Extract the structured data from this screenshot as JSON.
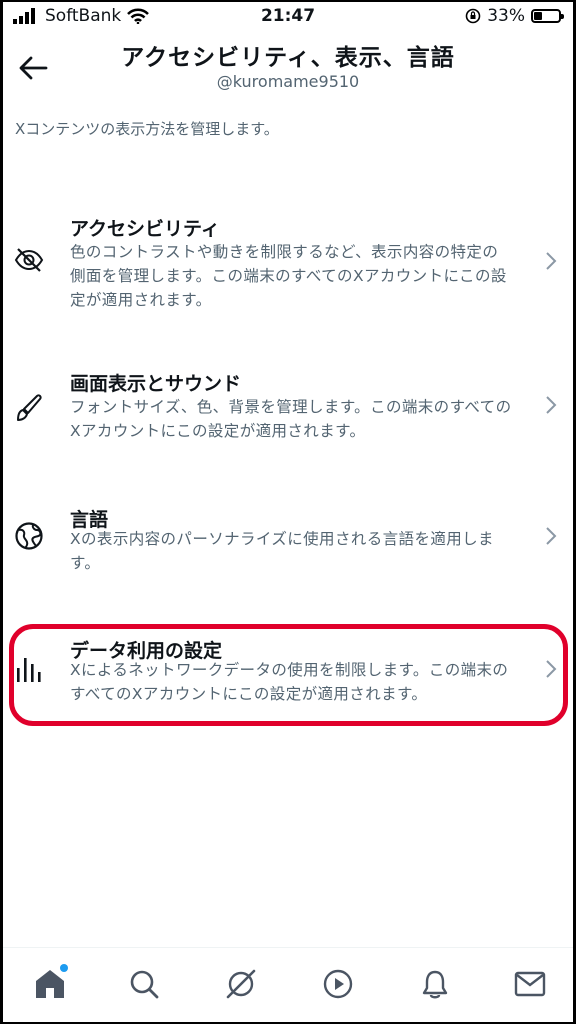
{
  "status_bar": {
    "carrier": "SoftBank",
    "time": "21:47",
    "battery": "33%",
    "battery_level": 0.33
  },
  "header": {
    "title": "アクセシビリティ、表示、言語",
    "username": "@kuromame9510",
    "description": "Xコンテンツの表示方法を管理します。"
  },
  "items": [
    {
      "title": "アクセシビリティ",
      "description": "色のコントラストや動きを制限するなど、表示内容の特定の側面を管理します。この端末のすべてのXアカウントにこの設定が適用されます。",
      "icon": "eye-slash-icon"
    },
    {
      "title": "画面表示とサウンド",
      "description": "フォントサイズ、色、背景を管理します。この端末のすべてのXアカウントにこの設定が適用されます。",
      "icon": "paintbrush-icon"
    },
    {
      "title": "言語",
      "description": "Xの表示内容のパーソナライズに使用される言語を適用します。",
      "icon": "globe-icon"
    },
    {
      "title": "データ利用の設定",
      "description": "Xによるネットワークデータの使用を制限します。この端末のすべてのXアカウントにこの設定が適用されます。",
      "icon": "bar-chart-icon"
    }
  ],
  "nav": [
    "home-icon",
    "search-icon",
    "spaces-icon",
    "video-icon",
    "bell-icon",
    "mail-icon"
  ],
  "colors": {
    "highlight": "#e0002b",
    "text": "#0f1419",
    "secondary": "#536471",
    "accent": "#1d9bf0"
  }
}
